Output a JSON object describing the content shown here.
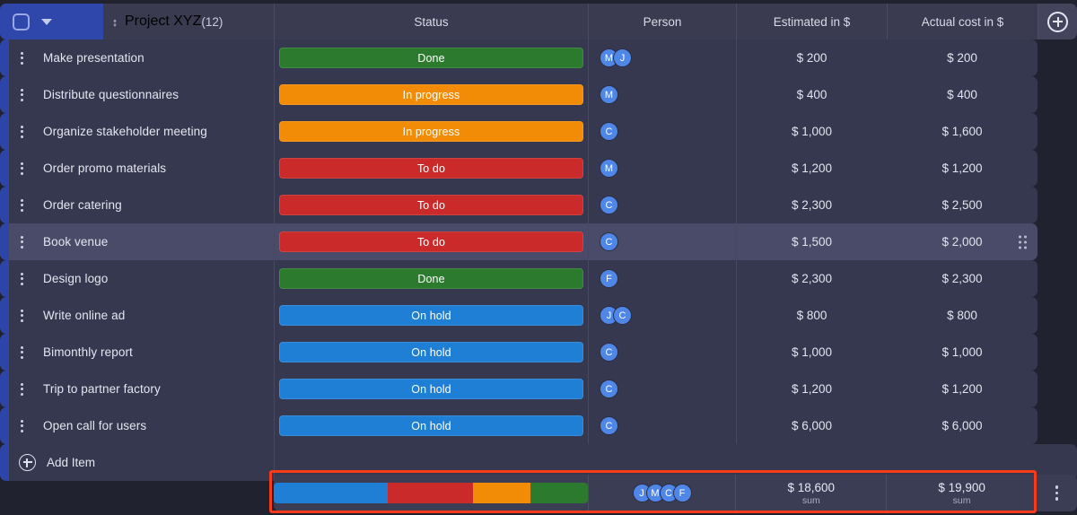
{
  "group": {
    "title": "Project XYZ",
    "count": "(12)",
    "checkbox_icon": "checkbox-icon",
    "collapse_icon": "chevron-down-icon",
    "drag_icon": "updown-arrow-icon",
    "accent_color": "#2f46ab"
  },
  "columns": {
    "status": "Status",
    "person": "Person",
    "estimated": "Estimated in $",
    "actual": "Actual cost in $",
    "add_column_icon": "plus-circle-icon"
  },
  "rows": [
    {
      "task": "Make presentation",
      "status": "Done",
      "status_color": "#2b7a2e",
      "people": [
        "M",
        "J"
      ],
      "estimated": "$ 200",
      "actual": "$ 200",
      "selected": false
    },
    {
      "task": "Distribute questionnaires",
      "status": "In progress",
      "status_color": "#f28b05",
      "people": [
        "M"
      ],
      "estimated": "$ 400",
      "actual": "$ 400",
      "selected": false
    },
    {
      "task": "Organize stakeholder meeting",
      "status": "In progress",
      "status_color": "#f28b05",
      "people": [
        "C"
      ],
      "estimated": "$ 1,000",
      "actual": "$ 1,600",
      "selected": false
    },
    {
      "task": "Order promo materials",
      "status": "To do",
      "status_color": "#ca2a2a",
      "people": [
        "M"
      ],
      "estimated": "$ 1,200",
      "actual": "$ 1,200",
      "selected": false
    },
    {
      "task": "Order catering",
      "status": "To do",
      "status_color": "#ca2a2a",
      "people": [
        "C"
      ],
      "estimated": "$ 2,300",
      "actual": "$ 2,500",
      "selected": false
    },
    {
      "task": "Book venue",
      "status": "To do",
      "status_color": "#ca2a2a",
      "people": [
        "C"
      ],
      "estimated": "$ 1,500",
      "actual": "$ 2,000",
      "selected": true
    },
    {
      "task": "Design logo",
      "status": "Done",
      "status_color": "#2b7a2e",
      "people": [
        "F"
      ],
      "estimated": "$ 2,300",
      "actual": "$ 2,300",
      "selected": false
    },
    {
      "task": "Write online ad",
      "status": "On hold",
      "status_color": "#1f7fd4",
      "people": [
        "J",
        "C"
      ],
      "estimated": "$ 800",
      "actual": "$ 800",
      "selected": false
    },
    {
      "task": "Bimonthly report",
      "status": "On hold",
      "status_color": "#1f7fd4",
      "people": [
        "C"
      ],
      "estimated": "$ 1,000",
      "actual": "$ 1,000",
      "selected": false
    },
    {
      "task": "Trip to partner factory",
      "status": "On hold",
      "status_color": "#1f7fd4",
      "people": [
        "C"
      ],
      "estimated": "$ 1,200",
      "actual": "$ 1,200",
      "selected": false
    },
    {
      "task": "Open call for users",
      "status": "On hold",
      "status_color": "#1f7fd4",
      "people": [
        "C"
      ],
      "estimated": "$ 6,000",
      "actual": "$ 6,000",
      "selected": false
    }
  ],
  "add_item": {
    "label": "Add Item",
    "icon": "plus-circle-icon"
  },
  "summary": {
    "segments": [
      {
        "status": "On hold",
        "color": "#1f7fd4",
        "count": 4
      },
      {
        "status": "To do",
        "color": "#ca2a2a",
        "count": 3
      },
      {
        "status": "In progress",
        "color": "#f28b05",
        "count": 2
      },
      {
        "status": "Done",
        "color": "#2b7a2e",
        "count": 2
      }
    ],
    "people": [
      "J",
      "M",
      "C",
      "F"
    ],
    "estimated_value": "$ 18,600",
    "estimated_label": "sum",
    "actual_value": "$ 19,900",
    "actual_label": "sum",
    "menu_icon": "kebab-menu-icon",
    "highlight_color": "#f93a1a"
  }
}
